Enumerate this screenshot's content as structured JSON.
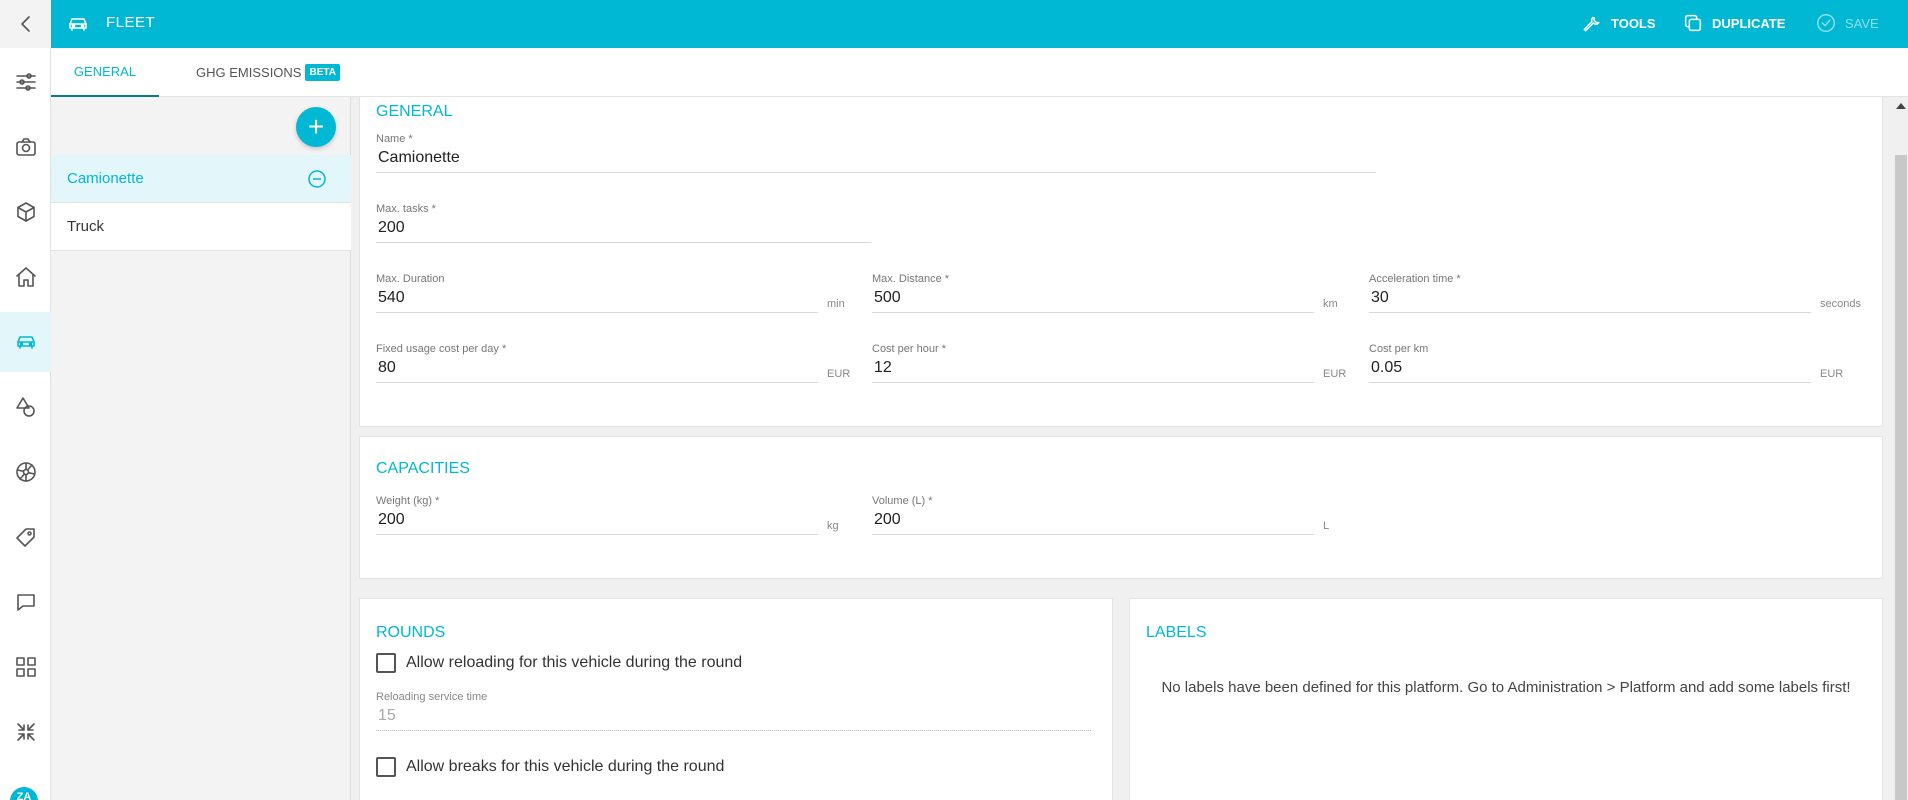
{
  "topbar": {
    "title": "FLEET",
    "tools_label": "TOOLS",
    "duplicate_label": "DUPLICATE",
    "save_label": "SAVE"
  },
  "tabs": [
    {
      "label": "GENERAL"
    },
    {
      "label": "GHG EMISSIONS",
      "badge": "BETA"
    }
  ],
  "vehicles": [
    {
      "name": "Camionette"
    },
    {
      "name": "Truck"
    }
  ],
  "general": {
    "title": "GENERAL",
    "name": {
      "label": "Name *",
      "value": "Camionette"
    },
    "max_tasks": {
      "label": "Max. tasks *",
      "value": "200"
    },
    "max_duration": {
      "label": "Max. Duration",
      "value": "540",
      "unit": "min"
    },
    "max_distance": {
      "label": "Max. Distance *",
      "value": "500",
      "unit": "km"
    },
    "acceleration_time": {
      "label": "Acceleration time *",
      "value": "30",
      "unit": "seconds"
    },
    "fixed_cost": {
      "label": "Fixed usage cost per day *",
      "value": "80",
      "unit": "EUR"
    },
    "cost_per_hour": {
      "label": "Cost per hour *",
      "value": "12",
      "unit": "EUR"
    },
    "cost_per_km": {
      "label": "Cost per km",
      "value": "0.05",
      "unit": "EUR"
    }
  },
  "capacities": {
    "title": "CAPACITIES",
    "weight": {
      "label": "Weight (kg) *",
      "value": "200",
      "unit": "kg"
    },
    "volume": {
      "label": "Volume (L) *",
      "value": "200",
      "unit": "L"
    }
  },
  "rounds": {
    "title": "ROUNDS",
    "allow_reloading": "Allow reloading for this vehicle during the round",
    "reloading_service_time": {
      "label": "Reloading service time",
      "value": "15"
    },
    "allow_breaks": "Allow breaks for this vehicle during the round"
  },
  "labels": {
    "title": "LABELS",
    "message": "No labels have been defined for this platform. Go to Administration > Platform and add some labels first!"
  },
  "user": {
    "initials": "ZA"
  }
}
